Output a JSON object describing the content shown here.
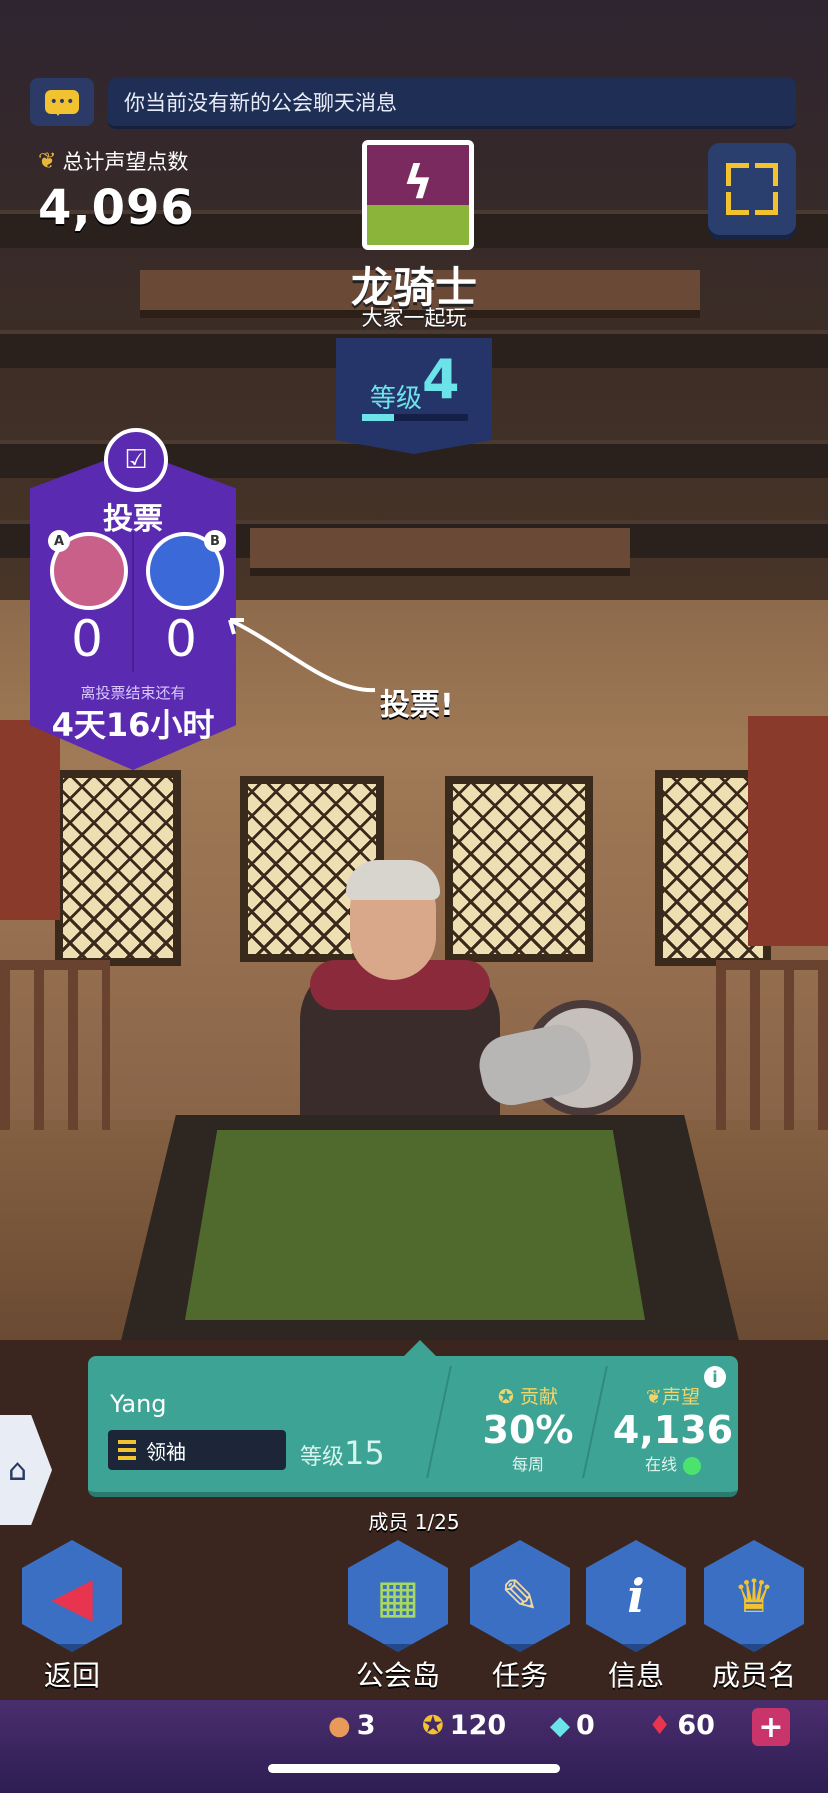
{
  "chat": {
    "message": "你当前没有新的公会聊天消息",
    "icon": "chat-bubble-icon"
  },
  "prestige": {
    "label": "总计声望点数",
    "value": "4,096",
    "icon": "laurel-icon"
  },
  "guild": {
    "name": "龙骑士",
    "motto": "大家一起玩",
    "level_label": "等级",
    "level_value": "4",
    "level_progress": 0.3,
    "emblem_icon": "lightning-bolt-icon"
  },
  "vote": {
    "title": "投票",
    "option_a": {
      "tag": "A",
      "count": "0"
    },
    "option_b": {
      "tag": "B",
      "count": "0"
    },
    "ends_label": "离投票结束还有",
    "ends_value": "4天16小时",
    "callout": "投票!"
  },
  "member": {
    "name": "Yang",
    "rank": "领袖",
    "level_label": "等级",
    "level_value": "15",
    "contribution_label": "贡献",
    "contribution_value": "30%",
    "contribution_period": "每周",
    "prestige_label": "声望",
    "prestige_value": "4,136",
    "status": "在线",
    "status_color": "#4be36e"
  },
  "member_count": "成员 1/25",
  "nav": {
    "back": "返回",
    "guild_island": "公会岛",
    "quests": "任务",
    "info": "信息",
    "members": "成员名单"
  },
  "resources": {
    "food": "3",
    "stars": "120",
    "crystals": "0",
    "gems": "60"
  }
}
